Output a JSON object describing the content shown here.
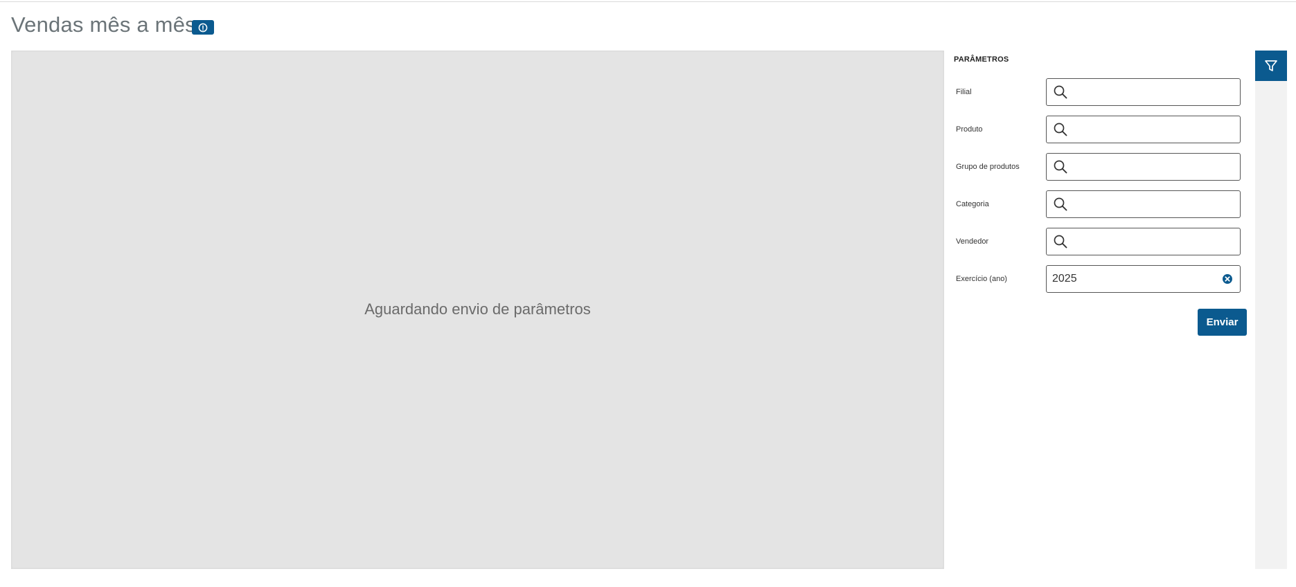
{
  "page": {
    "title": "Vendas mês a mês",
    "info_icon": "info-icon"
  },
  "report": {
    "waiting_message": "Aguardando envio de parâmetros"
  },
  "parameters": {
    "section_title": "PARÂMETROS",
    "fields": [
      {
        "label": "Filial",
        "value": "",
        "icon": "search-icon"
      },
      {
        "label": "Produto",
        "value": "",
        "icon": "search-icon"
      },
      {
        "label": "Grupo de produtos",
        "value": "",
        "icon": "search-icon"
      },
      {
        "label": "Categoria",
        "value": "",
        "icon": "search-icon"
      },
      {
        "label": "Vendedor",
        "value": "",
        "icon": "search-icon"
      },
      {
        "label": "Exercício (ano)",
        "value": "2025",
        "icon": "clear-icon"
      }
    ],
    "submit_label": "Enviar"
  },
  "sidebar": {
    "toggle_icon": "filter-icon"
  },
  "colors": {
    "accent": "#0b5a8f",
    "report_background": "#e4e4e4",
    "title_text": "#6b7478"
  }
}
